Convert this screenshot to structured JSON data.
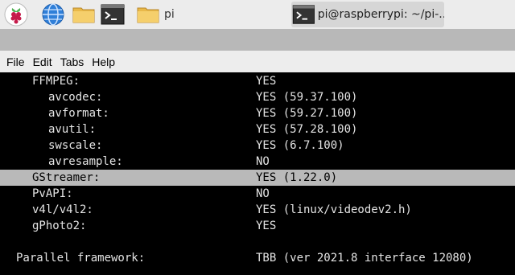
{
  "taskbar": {
    "launcher_icon": "raspberry-pi-menu-icon",
    "browser_icon": "globe-icon",
    "files_icon": "folder-icon",
    "terminal_icon": "terminal-icon",
    "tasks": [
      {
        "label": "pi",
        "icon": "folder-icon"
      },
      {
        "label": "pi@raspberrypi: ~/pi-...",
        "icon": "terminal-icon",
        "active": true
      }
    ]
  },
  "menubar": {
    "items": [
      "File",
      "Edit",
      "Tabs",
      "Help"
    ]
  },
  "terminal": {
    "lines": [
      {
        "key": "FFMPEG:",
        "value": "YES",
        "indent": 1
      },
      {
        "key": "avcodec:",
        "value": "YES (59.37.100)",
        "indent": 2
      },
      {
        "key": "avformat:",
        "value": "YES (59.27.100)",
        "indent": 2
      },
      {
        "key": "avutil:",
        "value": "YES (57.28.100)",
        "indent": 2
      },
      {
        "key": "swscale:",
        "value": "YES (6.7.100)",
        "indent": 2
      },
      {
        "key": "avresample:",
        "value": "NO",
        "indent": 2
      },
      {
        "key": "GStreamer:",
        "value": "YES (1.22.0)",
        "indent": 1,
        "highlighted": true
      },
      {
        "key": "PvAPI:",
        "value": "NO",
        "indent": 1
      },
      {
        "key": "v4l/v4l2:",
        "value": "YES (linux/videodev2.h)",
        "indent": 1
      },
      {
        "key": "gPhoto2:",
        "value": "YES",
        "indent": 1
      },
      {
        "key": "",
        "value": "",
        "indent": 0
      },
      {
        "key": "Parallel framework:",
        "value": "TBB (ver 2021.8 interface 12080)",
        "indent": 0
      }
    ]
  },
  "colors": {
    "terminal_bg": "#000000",
    "terminal_fg": "#e4e4e4",
    "highlight_bg": "#b9b9b9",
    "panel_bg": "#ececec"
  }
}
